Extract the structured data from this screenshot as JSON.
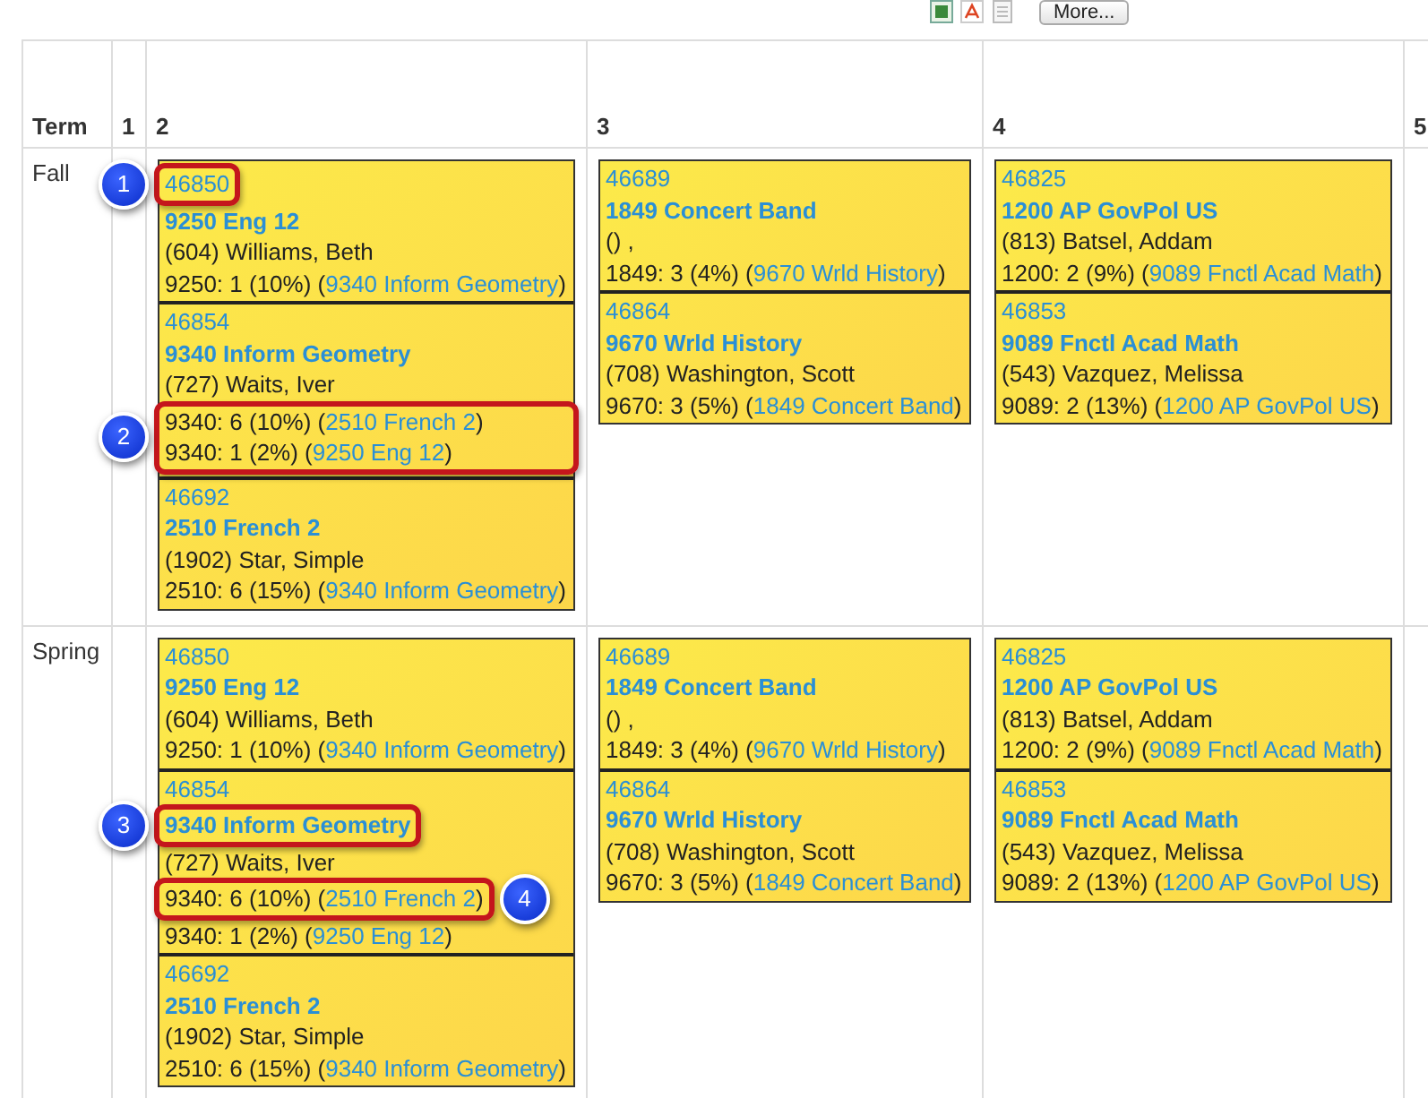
{
  "toolbar": {
    "button": "More..."
  },
  "table": {
    "columns": [
      "Term",
      "1",
      "2",
      "3",
      "4",
      "5"
    ],
    "rows": [
      {
        "term": "Fall",
        "slots": [
          {
            "kind": "empty"
          },
          {
            "kind": "block",
            "sections": [
              {
                "id": "46850",
                "title": "9250 Eng 12",
                "teacher": "(604) Williams, Beth",
                "stats": [
                  {
                    "text": "9250: 1 (10%) (",
                    "link": "9340 Inform Geometry",
                    "end": ")"
                  }
                ],
                "id_callout": "1"
              },
              {
                "id": "46854",
                "title": "9340 Inform Geometry",
                "teacher": "(727) Waits, Iver",
                "stats": [
                  {
                    "text": "9340: 6 (10%) (",
                    "link": "2510 French 2",
                    "end": ")"
                  },
                  {
                    "text": "9340: 1 (2%) (",
                    "link": "9250 Eng 12",
                    "end": ")"
                  }
                ],
                "stats_callout": "2"
              },
              {
                "id": "46692",
                "title": "2510 French 2",
                "teacher": "(1902) Star, Simple",
                "stats": [
                  {
                    "text": "2510: 6 (15%) (",
                    "link": "9340 Inform Geometry",
                    "end": ")"
                  }
                ]
              }
            ]
          },
          {
            "kind": "block",
            "sections": [
              {
                "id": "46689",
                "title": "1849 Concert Band",
                "teacher": "() ,",
                "stats": [
                  {
                    "text": "1849: 3 (4%) (",
                    "link": "9670 Wrld History",
                    "end": ")"
                  }
                ]
              },
              {
                "id": "46864",
                "title": "9670 Wrld History",
                "teacher": "(708) Washington, Scott",
                "stats": [
                  {
                    "text": "9670: 3 (5%) (",
                    "link": "1849 Concert Band",
                    "end": ")"
                  }
                ]
              }
            ]
          },
          {
            "kind": "block",
            "sections": [
              {
                "id": "46825",
                "title": "1200 AP GovPol US",
                "teacher": "(813) Batsel, Addam",
                "stats": [
                  {
                    "text": "1200: 2 (9%) (",
                    "link": "9089 Fnctl Acad Math",
                    "end": ")"
                  }
                ]
              },
              {
                "id": "46853",
                "title": "9089 Fnctl Acad Math",
                "teacher": "(543) Vazquez, Melissa",
                "stats": [
                  {
                    "text": "9089: 2 (13%) (",
                    "link": "1200 AP GovPol US",
                    "end": ")"
                  }
                ]
              }
            ]
          },
          {
            "kind": "empty"
          }
        ]
      },
      {
        "term": "Spring",
        "slots": [
          {
            "kind": "empty"
          },
          {
            "kind": "block",
            "sections": [
              {
                "id": "46850",
                "title": "9250 Eng 12",
                "teacher": "(604) Williams, Beth",
                "stats": [
                  {
                    "text": "9250: 1 (10%) (",
                    "link": "9340 Inform Geometry",
                    "end": ")"
                  }
                ]
              },
              {
                "id": "46854",
                "title": "9340 Inform Geometry",
                "teacher": "(727) Waits, Iver",
                "stats": [
                  {
                    "text": "9340: 6 (10%) (",
                    "link": "2510 French 2",
                    "end": ")",
                    "callout": "4"
                  },
                  {
                    "text": "9340: 1 (2%) (",
                    "link": "9250 Eng 12",
                    "end": ")"
                  }
                ],
                "title_callout": "3"
              },
              {
                "id": "46692",
                "title": "2510 French 2",
                "teacher": "(1902) Star, Simple",
                "stats": [
                  {
                    "text": "2510: 6 (15%) (",
                    "link": "9340 Inform Geometry",
                    "end": ")"
                  }
                ]
              }
            ]
          },
          {
            "kind": "block",
            "sections": [
              {
                "id": "46689",
                "title": "1849 Concert Band",
                "teacher": "() ,",
                "stats": [
                  {
                    "text": "1849: 3 (4%) (",
                    "link": "9670 Wrld History",
                    "end": ")"
                  }
                ]
              },
              {
                "id": "46864",
                "title": "9670 Wrld History",
                "teacher": "(708) Washington, Scott",
                "stats": [
                  {
                    "text": "9670: 3 (5%) (",
                    "link": "1849 Concert Band",
                    "end": ")"
                  }
                ]
              }
            ]
          },
          {
            "kind": "block",
            "sections": [
              {
                "id": "46825",
                "title": "1200 AP GovPol US",
                "teacher": "(813) Batsel, Addam",
                "stats": [
                  {
                    "text": "1200: 2 (9%) (",
                    "link": "9089 Fnctl Acad Math",
                    "end": ")"
                  }
                ]
              },
              {
                "id": "46853",
                "title": "9089 Fnctl Acad Math",
                "teacher": "(543) Vazquez, Melissa",
                "stats": [
                  {
                    "text": "9089: 2 (13%) (",
                    "link": "1200 AP GovPol US",
                    "end": ")"
                  }
                ]
              }
            ]
          },
          {
            "kind": "empty"
          }
        ]
      }
    ]
  }
}
